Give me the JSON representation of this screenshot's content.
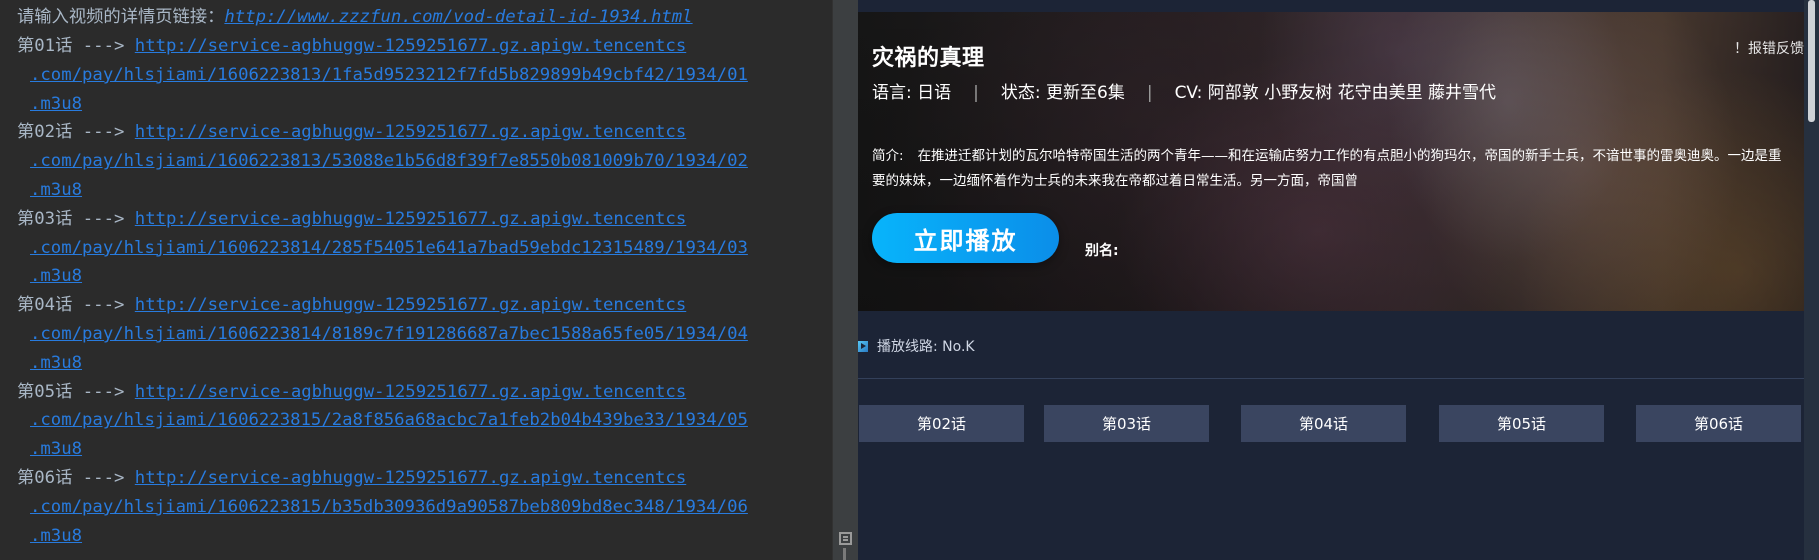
{
  "console": {
    "prompt": "请输入视频的详情页链接：",
    "detail_url": "http://www.zzzfun.com/vod-detail-id-1934.html",
    "episodes": [
      {
        "prefix": "第01话 ---> ",
        "url_line1": "http://service-agbhuggw-1259251677.gz.apigw.tencentcs",
        "url_line2": ".com/pay/hlsjiami/1606223813/1fa5d9523212f7fd5b829899b49cbf42/1934/01",
        "url_line3": ".m3u8"
      },
      {
        "prefix": "第02话 ---> ",
        "url_line1": "http://service-agbhuggw-1259251677.gz.apigw.tencentcs",
        "url_line2": ".com/pay/hlsjiami/1606223813/53088e1b56d8f39f7e8550b081009b70/1934/02",
        "url_line3": ".m3u8"
      },
      {
        "prefix": "第03话 ---> ",
        "url_line1": "http://service-agbhuggw-1259251677.gz.apigw.tencentcs",
        "url_line2": ".com/pay/hlsjiami/1606223814/285f54051e641a7bad59ebdc12315489/1934/03",
        "url_line3": ".m3u8"
      },
      {
        "prefix": "第04话 ---> ",
        "url_line1": "http://service-agbhuggw-1259251677.gz.apigw.tencentcs",
        "url_line2": ".com/pay/hlsjiami/1606223814/8189c7f191286687a7bec1588a65fe05/1934/04",
        "url_line3": ".m3u8"
      },
      {
        "prefix": "第05话 ---> ",
        "url_line1": "http://service-agbhuggw-1259251677.gz.apigw.tencentcs",
        "url_line2": ".com/pay/hlsjiami/1606223815/2a8f856a68acbc7a1feb2b04b439be33/1934/05",
        "url_line3": ".m3u8"
      },
      {
        "prefix": "第06话 ---> ",
        "url_line1": "http://service-agbhuggw-1259251677.gz.apigw.tencentcs",
        "url_line2": ".com/pay/hlsjiami/1606223815/b35db30936d9a90587beb809bd8ec348/1934/06",
        "url_line3": ".m3u8"
      }
    ]
  },
  "detail": {
    "title": "灾祸的真理",
    "report_label": "！报错反馈",
    "language": "语言: 日语",
    "status": "状态: 更新至6集",
    "cv": "CV: 阿部敦 小野友树 花守由美里 藤井雪代",
    "synopsis_label": "简介:",
    "synopsis": "在推进迁都计划的瓦尔哈特帝国生活的两个青年——和在运输店努力工作的有点胆小的狗玛尔，帝国的新手士兵，不谙世事的雷奥迪奥。一边是重要的妹妹，一边缅怀着作为士兵的未来我在帝都过着日常生活。另一方面，帝国曾",
    "play_button": "立即播放",
    "alias_label": "别名:",
    "source_label": "播放线路: No.K",
    "episode_buttons": [
      "第02话",
      "第03话",
      "第04话",
      "第05话",
      "第06话"
    ]
  },
  "colors": {
    "console_bg": "#2b2b2b",
    "console_text": "#a9b7c6",
    "link": "#287bde",
    "page_bg": "#1c2436",
    "play_button": "#0b9bf2",
    "episode_button": "#3a4560"
  }
}
